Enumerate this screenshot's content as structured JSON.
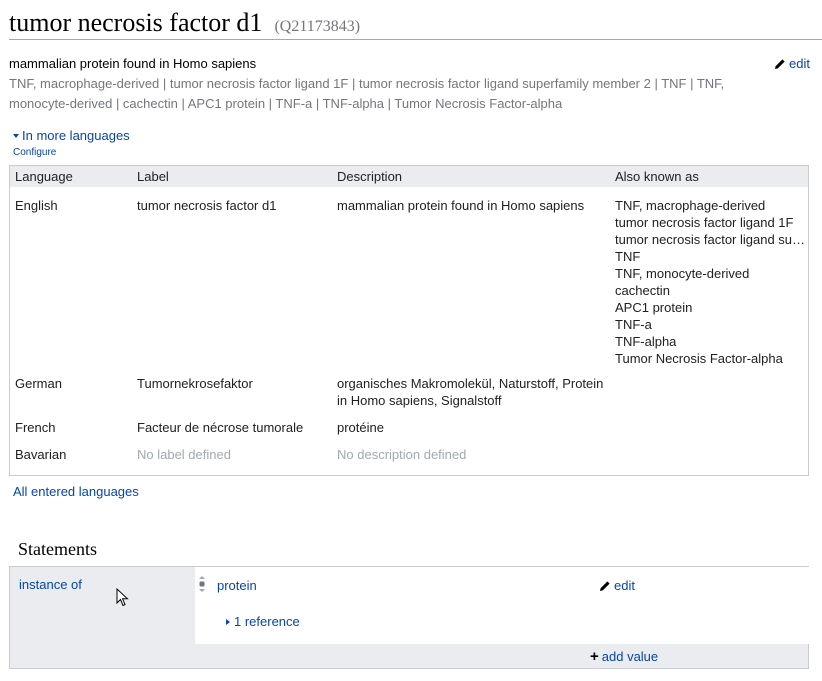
{
  "page": {
    "title": "tumor necrosis factor d1",
    "id": "(Q21173843)"
  },
  "summary": {
    "description": "mammalian protein found in Homo sapiens",
    "aliases": "TNF, macrophage-derived | tumor necrosis factor ligand 1F | tumor necrosis factor ligand superfamily member 2 | TNF | TNF, monocyte-derived | cachectin | APC1 protein | TNF-a | TNF-alpha | Tumor Necrosis Factor-alpha",
    "edit_label": "edit"
  },
  "languages": {
    "toggle_label": "In more languages",
    "configure_label": "Configure",
    "all_languages_label": "All entered languages",
    "headers": {
      "language": "Language",
      "label": "Label",
      "description": "Description",
      "aliases": "Also known as"
    },
    "rows": [
      {
        "language": "English",
        "label": "tumor necrosis factor d1",
        "description": "mammalian protein found in Homo sapiens",
        "aliases": [
          "TNF, macrophage-derived",
          "tumor necrosis factor ligand 1F",
          "tumor necrosis factor ligand su…",
          "TNF",
          "TNF, monocyte-derived",
          "cachectin",
          "APC1 protein",
          "TNF-a",
          "TNF-alpha",
          "Tumor Necrosis Factor-alpha"
        ]
      },
      {
        "language": "German",
        "label": "Tumornekrosefaktor",
        "description": "organisches Makromolekül, Naturstoff, Protein in Homo sapiens, Signalstoff",
        "aliases": []
      },
      {
        "language": "French",
        "label": "Facteur de nécrose tumorale",
        "description": "protéine",
        "aliases": []
      },
      {
        "language": "Bavarian",
        "label": "No label defined",
        "description": "No description defined",
        "aliases": []
      }
    ]
  },
  "statements": {
    "heading": "Statements",
    "items": [
      {
        "property": "instance of",
        "value": "protein",
        "edit_label": "edit",
        "reference_label": "1 reference",
        "add_value_label": "add value"
      }
    ]
  },
  "icons": {
    "edit": "pencil-icon",
    "rank": "normal-rank-icon",
    "toggle": "triangle-down-icon",
    "reference_toggle": "triangle-right-icon",
    "add": "plus-icon",
    "cursor": "mouse-pointer-icon"
  },
  "colors": {
    "link": "#0645ad",
    "muted": "#72777d",
    "header_bg": "#eaecf0",
    "border": "#c8ccd1"
  }
}
